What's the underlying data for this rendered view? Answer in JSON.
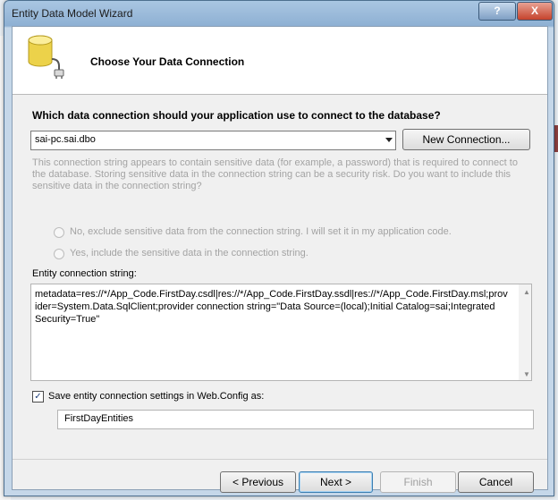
{
  "window": {
    "title": "Entity Data Model Wizard",
    "help_label": "?",
    "close_label": "X"
  },
  "header": {
    "title": "Choose Your Data Connection"
  },
  "connection": {
    "question": "Which data connection should your application use to connect to the database?",
    "selected": "sai-pc.sai.dbo",
    "new_connection_label": "New Connection..."
  },
  "sensitive": {
    "message": "This connection string appears to contain sensitive data (for example, a password) that is required to connect to the database. Storing sensitive data in the connection string can be a security risk. Do you want to include this sensitive data in the connection string?",
    "option_no": "No, exclude sensitive data from the connection string. I will set it in my application code.",
    "option_yes": "Yes, include the sensitive data in the connection string."
  },
  "entity": {
    "label": "Entity connection string:",
    "value": "metadata=res://*/App_Code.FirstDay.csdl|res://*/App_Code.FirstDay.ssdl|res://*/App_Code.FirstDay.msl;provider=System.Data.SqlClient;provider connection string=\"Data Source=(local);Initial Catalog=sai;Integrated Security=True\"",
    "scroll_up": "▲",
    "scroll_down": "▼"
  },
  "save": {
    "checked": true,
    "check_mark": "✓",
    "label": "Save entity connection settings in Web.Config as:",
    "name": "FirstDayEntities"
  },
  "buttons": {
    "previous": "< Previous",
    "next": "Next >",
    "finish": "Finish",
    "cancel": "Cancel"
  },
  "colors": {
    "title_bar": "#8eb0d3",
    "close_button": "#c5432c",
    "disabled_text": "#a3a3a3"
  },
  "icons": {
    "header": "database-plug-icon"
  }
}
